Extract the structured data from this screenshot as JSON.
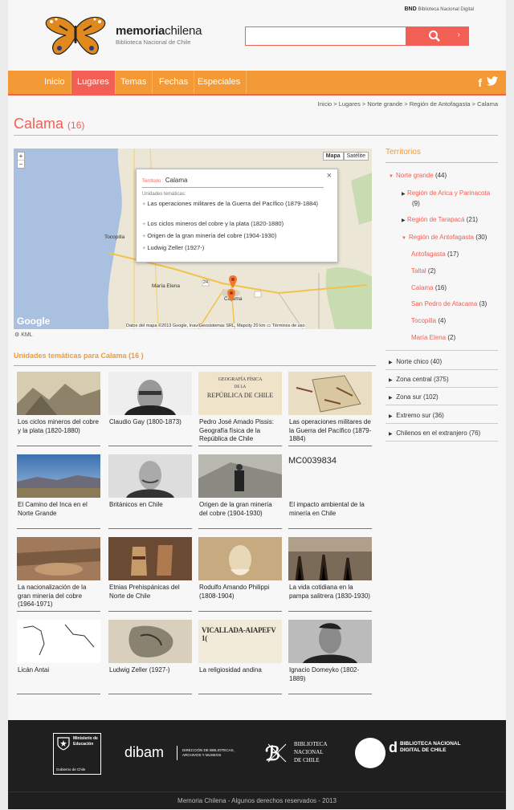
{
  "header": {
    "bnd_short": "BND",
    "bnd_label": "Biblioteca Nacional Digital",
    "brand_part1": "memoria",
    "brand_part2": "chilena",
    "brand_sub": "Biblioteca Nacional de Chile",
    "search_value": "",
    "search_arrow": "›"
  },
  "nav": {
    "items": [
      "Inicio",
      "Lugares",
      "Temas",
      "Fechas",
      "Especiales"
    ],
    "active": "Lugares",
    "facebook": "f"
  },
  "breadcrumb": "Inicio > Lugares > Norte grande > Región de Antofagasta > Calama",
  "page": {
    "title": "Calama",
    "count": "(16)"
  },
  "map": {
    "btn_map": "Mapa",
    "btn_sat": "Satélite",
    "zoom_in": "+",
    "zoom_out": "−",
    "popup_territory_label": "Territorio :",
    "popup_territory": "Calama",
    "popup_close": "×",
    "popup_units_label": "Unidades temáticas:",
    "popup_items": [
      "Las operaciones militares de la Guerra del Pacífico (1879-1884)",
      "Los ciclos mineros del cobre y la plata (1820-1880)",
      "Origen de la gran minería del cobre (1904-1930)",
      "Ludwig Zeller (1927-)"
    ],
    "labels": {
      "tocopilla": "Tocopilla",
      "maria_elena": "María Elena",
      "calama": "Calama",
      "route": "24"
    },
    "google": "Google",
    "footer": "Datos del mapa ©2013 Google, Inav/Geosistemas SRL, Mapcity    20 km ▭    Términos de uso",
    "kml": "KML"
  },
  "units": {
    "title": "Unidades temáticas para Calama (16 )",
    "cards": [
      {
        "label": "Los ciclos mineros del cobre y la plata (1820-1880)"
      },
      {
        "label": "Claudio Gay (1800-1873)"
      },
      {
        "label": "Pedro José Amado Pissis: Geografía física de la República de Chile"
      },
      {
        "label": "Las operaciones militares de la Guerra del Pacífico (1879-1884)"
      },
      {
        "label": "El Camino del Inca en el Norte Grande"
      },
      {
        "label": "Británicos en Chile"
      },
      {
        "label": "Origen de la gran minería del cobre (1904-1930)"
      },
      {
        "label": "El impacto ambiental de la minería en Chile",
        "code": "MC0039834"
      },
      {
        "label": "La nacionalización de la gran minería del cobre (1964-1971)"
      },
      {
        "label": "Etnias Prehispánicas del Norte de Chile"
      },
      {
        "label": "Rodulfo Amando Philippi (1808-1904)"
      },
      {
        "label": "La vida cotidiana en la pampa salitrera (1830-1930)"
      },
      {
        "label": "Licán Antai"
      },
      {
        "label": "Ludwig Zeller (1927-)"
      },
      {
        "label": "La religiosidad andina"
      },
      {
        "label": "Ignacio Domeyko (1802-1889)"
      }
    ],
    "img_texts": {
      "geo_line1": "GEOGRAFÍA FÍSICA",
      "geo_line2": "DE LA",
      "geo_line3": "REPÚBLICA DE CHILE",
      "relig": "VICALLADA-AIAPEFV 1("
    }
  },
  "sidebar": {
    "title": "Territorios",
    "norte_grande": {
      "label": "Norte grande",
      "count": "(44)"
    },
    "regions": [
      {
        "label": "Región de Arica y Parinacota",
        "count": "(9)"
      },
      {
        "label": "Región de Tarapacá",
        "count": "(21)"
      },
      {
        "label": "Región de Antofagasta",
        "count": "(30)"
      }
    ],
    "comunas": [
      {
        "label": "Antofagasta",
        "count": "(17)"
      },
      {
        "label": "Taltal",
        "count": "(2)"
      },
      {
        "label": "Calama",
        "count": "(16)"
      },
      {
        "label": "San Pedro de Atacama",
        "count": "(3)"
      },
      {
        "label": "Tocopilla",
        "count": "(4)"
      },
      {
        "label": "María Elena",
        "count": "(2)"
      }
    ],
    "zones": [
      {
        "label": "Norte chico",
        "count": "(40)"
      },
      {
        "label": "Zona central",
        "count": "(375)"
      },
      {
        "label": "Zona sur",
        "count": "(102)"
      },
      {
        "label": "Extremo sur",
        "count": "(36)"
      },
      {
        "label": "Chilenos en el extranjero",
        "count": "(76)"
      }
    ]
  },
  "footer": {
    "ministerio_1": "Ministerio de",
    "ministerio_2": "Educación",
    "gobierno": "Gobierno de Chile",
    "dibam": "dibam",
    "dibam_sub1": "DIRECCIÓN DE BIBLIOTECAS,",
    "dibam_sub2": "ARCHIVOS Y MUSEOS",
    "bn1": "BIBLIOTECA",
    "bn2": "NACIONAL",
    "bn3": "DE CHILE",
    "bnd1": "BIBLIOTECA NACIONAL",
    "bnd2": "DIGITAL DE CHILE",
    "copyright": "Memoria Chilena - Algunos derechos reservados - 2013"
  },
  "colors": {
    "accent": "#f15f55",
    "nav": "#f39a36"
  }
}
